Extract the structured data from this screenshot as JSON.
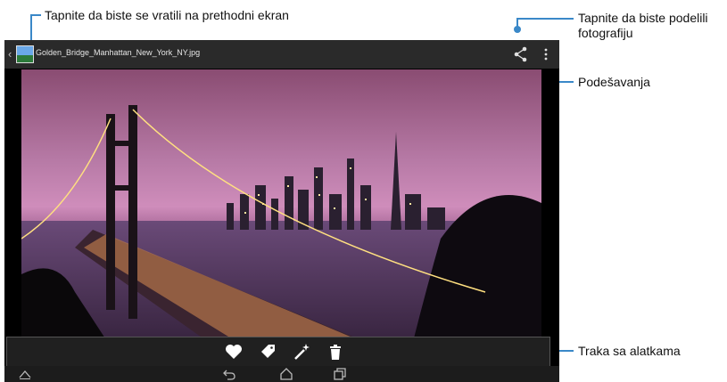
{
  "callouts": {
    "back": "Tapnite da biste se vratili na prethodni ekran",
    "share_line1": "Tapnite da biste podelili",
    "share_line2": "fotografiju",
    "settings": "Podešavanja",
    "toolbar": "Traka sa alatkama"
  },
  "app": {
    "filename": "Golden_Bridge_Manhattan_New_York_NY.jpg"
  },
  "icons": {
    "back": "chevron-left-icon",
    "thumbnail": "gallery-thumbnail-icon",
    "share": "share-icon",
    "menu": "overflow-menu-icon",
    "favorite": "heart-icon",
    "tag": "tag-icon",
    "edit": "magic-wand-icon",
    "delete": "trash-icon",
    "nav_up": "chevron-up-icon",
    "nav_back": "nav-back-icon",
    "nav_home": "home-icon",
    "nav_recents": "recents-icon"
  },
  "colors": {
    "callout_line": "#3a88c8",
    "bar_bg": "#2a2a2a"
  }
}
